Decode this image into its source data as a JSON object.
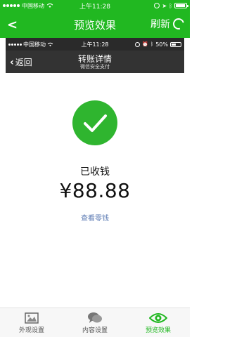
{
  "outer_status": {
    "carrier": "中国移动",
    "time": "上午11:28"
  },
  "outer_nav": {
    "back_glyph": "<",
    "title": "预览效果",
    "refresh_label": "刷新"
  },
  "inner_status": {
    "carrier": "中国移动",
    "time": "上午11:28",
    "battery": "50%"
  },
  "inner_nav": {
    "back_label": "返回",
    "title": "转账详情",
    "subtitle": "微信安全支付"
  },
  "receipt": {
    "status": "已收钱",
    "amount": "¥88.88",
    "link": "查看零钱"
  },
  "tabs": [
    {
      "label": "外观设置",
      "icon": "image-icon",
      "active": false
    },
    {
      "label": "内容设置",
      "icon": "chat-icon",
      "active": false
    },
    {
      "label": "预览效果",
      "icon": "eye-icon",
      "active": true
    }
  ],
  "colors": {
    "brand_green": "#21b821",
    "inner_bar": "#333333",
    "link_blue": "#5b7ab3"
  }
}
